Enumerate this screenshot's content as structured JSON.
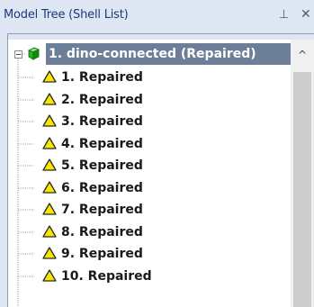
{
  "panel": {
    "title": "Model Tree (Shell List)",
    "pin_icon": "pin-icon",
    "pin_glyph": "⊥",
    "close_icon": "close-icon",
    "close_glyph": "✕"
  },
  "tree": {
    "root": {
      "label": "1. dino-connected (Repaired)",
      "icon": "green-cube-icon",
      "expanded": true,
      "selected": true
    },
    "children": [
      {
        "label": "1. Repaired",
        "icon": "warning-triangle-icon"
      },
      {
        "label": "2. Repaired",
        "icon": "warning-triangle-icon"
      },
      {
        "label": "3. Repaired",
        "icon": "warning-triangle-icon"
      },
      {
        "label": "4. Repaired",
        "icon": "warning-triangle-icon"
      },
      {
        "label": "5. Repaired",
        "icon": "warning-triangle-icon"
      },
      {
        "label": "6. Repaired",
        "icon": "warning-triangle-icon"
      },
      {
        "label": "7. Repaired",
        "icon": "warning-triangle-icon"
      },
      {
        "label": "8. Repaired",
        "icon": "warning-triangle-icon"
      },
      {
        "label": "9. Repaired",
        "icon": "warning-triangle-icon"
      },
      {
        "label": "10. Repaired",
        "icon": "warning-triangle-icon"
      }
    ]
  },
  "scrollbar": {
    "up_glyph": "^"
  },
  "colors": {
    "panel_bg": "#dee6f3",
    "title_text": "#1b3a78",
    "selection_bg": "#6d7e99",
    "warning_yellow": "#f7e600",
    "cube_green": "#1fb51f"
  }
}
